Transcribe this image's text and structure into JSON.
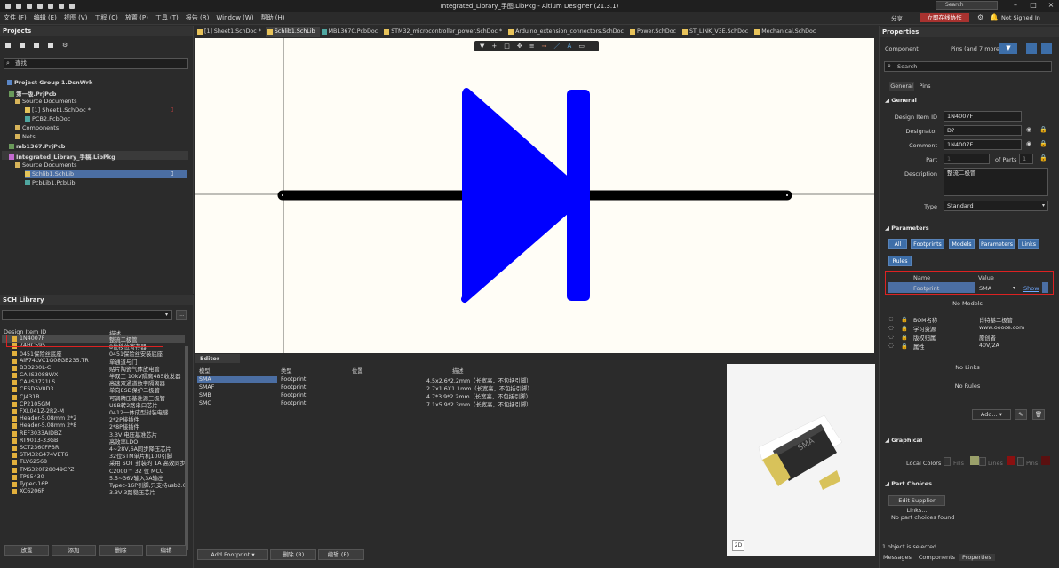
{
  "window": {
    "title": "Integrated_Library_手图.LibPkg - Altium Designer (21.3.1)",
    "search_placeholder": "Search"
  },
  "menu": [
    "文件 (F)",
    "编辑 (E)",
    "视图 (V)",
    "工程 (C)",
    "放置 (P)",
    "工具 (T)",
    "报告 (R)",
    "Window (W)",
    "帮助 (H)"
  ],
  "topright": {
    "share": "分享",
    "live": "立即在线协作",
    "signin": "Not Signed In"
  },
  "projects": {
    "title": "Projects",
    "search_placeholder": "查找",
    "tree": [
      {
        "label": "Project Group 1.DsnWrk",
        "bold": true
      },
      {
        "label": "第一版.PrjPcb",
        "bold": true
      },
      {
        "label": "Source Documents",
        "bold": false
      },
      {
        "label": "[1] Sheet1.SchDoc *",
        "bold": false
      },
      {
        "label": "PCB2.PcbDoc",
        "bold": false
      },
      {
        "label": "Components",
        "bold": false
      },
      {
        "label": "Nets",
        "bold": false
      },
      {
        "label": "mb1367.PrjPcb",
        "bold": true
      },
      {
        "label": "Integrated_Library_手稿.LibPkg",
        "bold": true
      },
      {
        "label": "Source Documents",
        "bold": false
      },
      {
        "label": "Schlib1.SchLib",
        "bold": false
      },
      {
        "label": "PcbLib1.PcbLib",
        "bold": false
      }
    ]
  },
  "schlib": {
    "title": "SCH Library",
    "col_id": "Design Item ID",
    "col_desc": "描述",
    "rows": [
      [
        "1N4007F",
        "整流二极管"
      ],
      [
        "74HC595",
        "8位移位寄存器"
      ],
      [
        "0451保险丝底座",
        "0451保险丝安装底座"
      ],
      [
        "AiP74LVC1G08GB235.TR",
        "单通道与门"
      ],
      [
        "B3D230L-C",
        "贴片陶瓷气体放电管"
      ],
      [
        "CA-IS3088WX",
        "半双工 10kV隔离485收发器"
      ],
      [
        "CA-IS3721LS",
        "高速双通道数字隔离器"
      ],
      [
        "CESD5V0D3",
        "单向ESD保护二极管"
      ],
      [
        "CJ431B",
        "可调精压基准源三极管"
      ],
      [
        "CP2105GM",
        "USB转2路串口芯片"
      ],
      [
        "FXL041Z-2R2-M",
        "0412一体成型封装电感"
      ],
      [
        "Header-5.08mm 2*2",
        "2*2P接插件"
      ],
      [
        "Header-5.08mm 2*8",
        "2*8P接插件"
      ],
      [
        "REF3033AIDBZ",
        "3.3V 电压基准芯片"
      ],
      [
        "RT9013-33GB",
        "高效率LDO"
      ],
      [
        "SCT2360FPBR",
        "4~28V,6A同步降压芯片"
      ],
      [
        "STM32G474VET6",
        "32位STM单片机100引脚"
      ],
      [
        "TLV62568",
        "采用 SOT 封装的 1A 高效同步"
      ],
      [
        "TMS320F28049CPZ",
        "C2000™ 32 位 MCU"
      ],
      [
        "TPS5430",
        "5.5~36V输入3A输出"
      ],
      [
        "Typec-16P",
        "Typec-16P引脚,只支持usb2.0"
      ],
      [
        "XC6206P",
        "3.3V 3路稳压芯片"
      ]
    ],
    "buttons": [
      "放置",
      "添加",
      "删除",
      "编辑"
    ]
  },
  "tabs": [
    "[1] Sheet1.SchDoc *",
    "Schlib1.SchLib",
    "MB1367C.PcbDoc",
    "STM32_microcontroller_power.SchDoc *",
    "Arduino_extension_connectors.SchDoc",
    "Power.SchDoc",
    "ST_LINK_V3E.SchDoc",
    "Mechanical.SchDoc"
  ],
  "editor": {
    "title": "Editor",
    "cols": [
      "模型",
      "类型",
      "位置",
      "描述"
    ],
    "rows": [
      [
        "SMA",
        "Footprint",
        "",
        "4.5x2.6*2.2mm（长宽高，不包括引脚）"
      ],
      [
        "SMAF",
        "Footprint",
        "",
        "2.7x1.6X1.1mm（长宽高，不包括引脚）"
      ],
      [
        "SMB",
        "Footprint",
        "",
        "4.7*3.9*2.2mm（长宽高，不包括引脚）"
      ],
      [
        "SMC",
        "Footprint",
        "",
        "7.1x5.9*2.3mm（长宽高，不包括引脚）"
      ]
    ],
    "buttons": [
      "Add Footprint",
      "删除 (R)",
      "编辑 (E)..."
    ],
    "view_mode": "2D",
    "chip_text": "SMA"
  },
  "properties": {
    "title": "Properties",
    "component": "Component",
    "filter": "Pins (and 7 more)",
    "search_placeholder": "Search",
    "tabs": [
      "General",
      "Pins"
    ],
    "general": {
      "section": "General",
      "design_item_id_label": "Design Item ID",
      "design_item_id": "1N4007F",
      "designator_label": "Designator",
      "designator": "D?",
      "comment_label": "Comment",
      "comment": "1N4007F",
      "part_label": "Part",
      "part_value": "1",
      "of_parts": "of Parts",
      "parts_count": "1",
      "description_label": "Description",
      "description": "整流二极管",
      "type_label": "Type",
      "type": "Standard"
    },
    "parameters": {
      "section": "Parameters",
      "filters": [
        "All",
        "Footprints",
        "Models",
        "Parameters",
        "Links",
        "Rules"
      ],
      "col_name": "Name",
      "col_value": "Value",
      "footprint_name": "Footprint",
      "footprint_value": "SMA",
      "show": "Show",
      "no_models": "No Models",
      "rows": [
        [
          "BOM名称",
          "肖特基二极管"
        ],
        [
          "学习资源",
          "www.oooce.com"
        ],
        [
          "版权归属",
          "原创者"
        ],
        [
          "属性",
          "40V/2A"
        ]
      ],
      "no_links": "No Links",
      "no_rules": "No Rules",
      "add": "Add..."
    },
    "graphical": {
      "section": "Graphical",
      "local_colors": "Local Colors",
      "fills": "Fills",
      "lines": "Lines",
      "pins": "Pins",
      "fill_color": "#9aa06a",
      "line_color": "#8a1010",
      "pin_color": "#5a1010"
    },
    "part_choices": {
      "section": "Part Choices",
      "edit_btn": "Edit Supplier Links...",
      "none": "No part choices found"
    },
    "status": "1 object is selected",
    "bottom_tabs": [
      "Messages",
      "Components",
      "Properties"
    ]
  },
  "colors": {
    "accent": "#3d6ea8",
    "diode": "#0000ff",
    "selected": "#4b6ea3",
    "highlight": "#d22222"
  }
}
